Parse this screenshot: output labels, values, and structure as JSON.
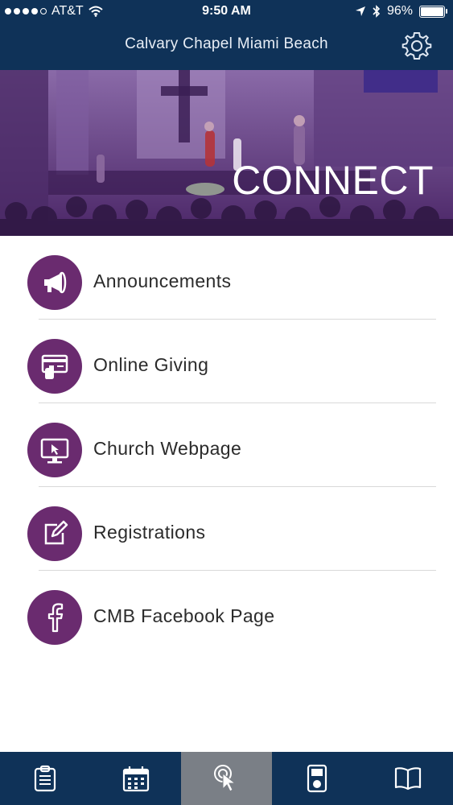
{
  "status_bar": {
    "carrier": "AT&T",
    "time": "9:50 AM",
    "battery": "96%",
    "battery_level": 0.96
  },
  "nav": {
    "title": "Calvary Chapel Miami Beach",
    "settings_icon": "gear-icon"
  },
  "hero": {
    "title": "CONNECT"
  },
  "menu": [
    {
      "label": "Announcements",
      "icon": "megaphone-icon"
    },
    {
      "label": "Online Giving",
      "icon": "card-tap-icon"
    },
    {
      "label": "Church Webpage",
      "icon": "monitor-cursor-icon"
    },
    {
      "label": "Registrations",
      "icon": "edit-icon"
    },
    {
      "label": "CMB Facebook Page",
      "icon": "facebook-icon"
    }
  ],
  "tabs": [
    {
      "name": "clipboard",
      "icon": "clipboard-icon",
      "active": false
    },
    {
      "name": "calendar",
      "icon": "calendar-icon",
      "active": false
    },
    {
      "name": "connect",
      "icon": "tap-icon",
      "active": true
    },
    {
      "name": "media",
      "icon": "ipod-icon",
      "active": false
    },
    {
      "name": "bible",
      "icon": "book-icon",
      "active": false
    }
  ],
  "colors": {
    "nav_bg": "#0f3258",
    "accent_circle": "#6a2b6f",
    "active_tab": "#7a7f86",
    "hero_tint": "#6a3d8f"
  }
}
